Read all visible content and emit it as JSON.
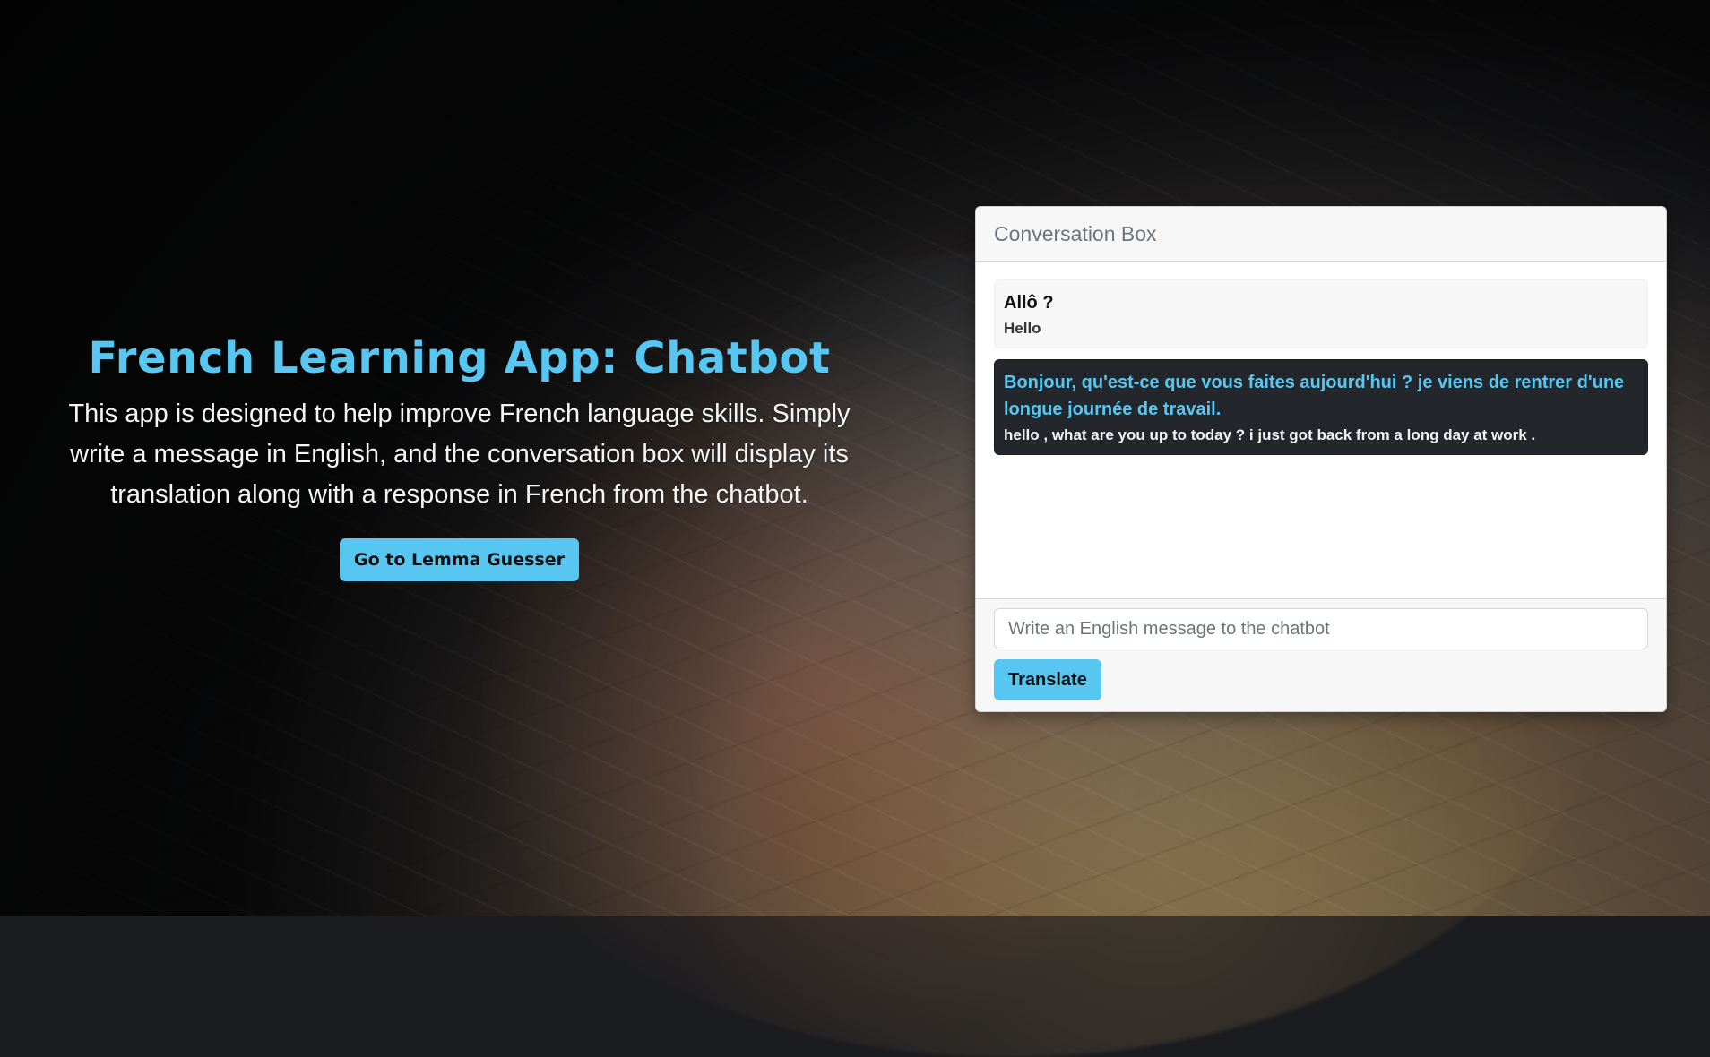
{
  "hero": {
    "title": "French Learning App: Chatbot",
    "description": "This app is designed to help improve French language skills. Simply write a message in English, and the conversation box will display its translation along with a response in French from the chatbot.",
    "button_label": "Go to Lemma Guesser"
  },
  "conversation": {
    "header": "Conversation Box",
    "messages": [
      {
        "french": "Allô ?",
        "english": "Hello"
      },
      {
        "french": "Bonjour, qu'est-ce que vous faites aujourd'hui ? je viens de rentrer d'une longue journée de travail.",
        "english": "hello , what are you up to today ? i just got back from a long day at work ."
      }
    ],
    "input": {
      "value": "",
      "placeholder": "Write an English message to the chatbot"
    },
    "translate_label": "Translate"
  },
  "colors": {
    "accent": "#57c7f2",
    "dark_message_bg": "#23272b"
  }
}
